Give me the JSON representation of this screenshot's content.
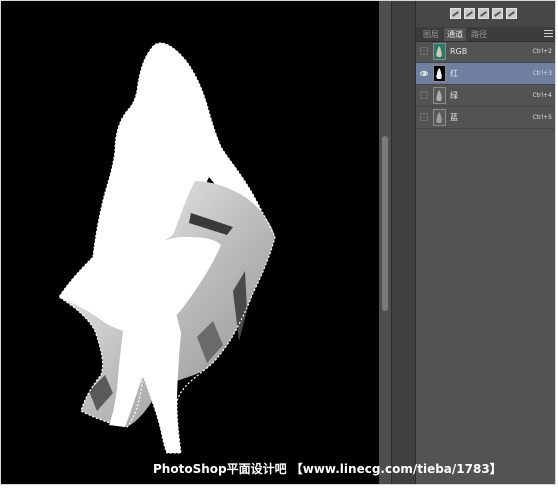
{
  "channels_panel": {
    "tabs": [
      {
        "label": "图层",
        "active": false
      },
      {
        "label": "通道",
        "active": true
      },
      {
        "label": "路径",
        "active": false
      }
    ],
    "toolbar_icons": [
      "adjustment-icon-1",
      "adjustment-icon-2",
      "adjustment-icon-3",
      "adjustment-icon-4",
      "adjustment-icon-5"
    ],
    "channels": [
      {
        "name": "RGB",
        "shortcut": "Ctrl+2",
        "visible": false,
        "selected": false,
        "thumb": "color"
      },
      {
        "name": "红",
        "shortcut": "Ctrl+3",
        "visible": true,
        "selected": true,
        "thumb": "mask"
      },
      {
        "name": "绿",
        "shortcut": "Ctrl+4",
        "visible": false,
        "selected": false,
        "thumb": "grey"
      },
      {
        "name": "蓝",
        "shortcut": "Ctrl+5",
        "visible": false,
        "selected": false,
        "thumb": "grey"
      }
    ]
  },
  "watermark": "PhotoShop平面设计吧 【www.linecg.com/tieba/1783】",
  "colors": {
    "canvas_bg": "#000000",
    "panel_bg": "#535353",
    "selected_row": "#6f7fa0",
    "silhouette": "#ffffff"
  }
}
